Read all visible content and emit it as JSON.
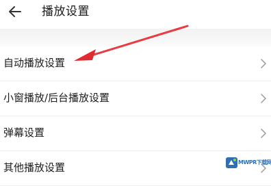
{
  "header": {
    "back_icon": "arrow-left-icon",
    "title": "播放设置"
  },
  "settings": {
    "items": [
      {
        "label": "自动播放设置",
        "icon": "chevron-right-icon"
      },
      {
        "label": "小窗播放/后台播放设置",
        "icon": "chevron-right-icon"
      },
      {
        "label": "弹幕设置",
        "icon": "chevron-right-icon"
      },
      {
        "label": "其他播放设置",
        "icon": "chevron-right-icon"
      }
    ]
  },
  "annotation": {
    "icon": "red-pointer-arrow",
    "color": "#e02b33"
  },
  "watermark": {
    "text": "MWPR下载网",
    "color": "#2f6fb2"
  },
  "colors": {
    "background": "#ffffff",
    "divider": "#f2f2f2",
    "chevron": "#9a9a9a"
  }
}
